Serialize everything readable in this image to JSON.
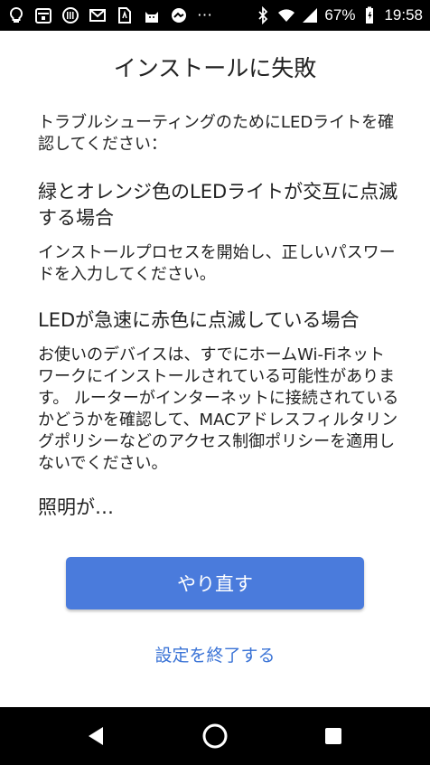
{
  "status_bar": {
    "icons": [
      "lightbulb-icon",
      "calendar-icon",
      "barcode-icon",
      "gmail-icon",
      "document-icon",
      "cat-icon",
      "camera-icon",
      "more-dots-icon",
      "bluetooth-icon",
      "wifi-icon",
      "signal-icon",
      "battery-icon"
    ],
    "dots": "⋯",
    "battery_percent": "67%",
    "time": "19:58"
  },
  "dialog": {
    "title": "インストールに失敗",
    "intro": "トラブルシューティングのためにLEDライトを確認してください：",
    "sections": [
      {
        "heading": "緑とオレンジ色のLEDライトが交互に点滅する場合",
        "body": "インストールプロセスを開始し、正しいパスワードを入力してください。"
      },
      {
        "heading": "LEDが急速に赤色に点滅している場合",
        "body": "お使いのデバイスは、すでにホームWi-Fiネットワークにインストールされている可能性があります。 ルーターがインターネットに接続されているかどうかを確認して、MACアドレスフィルタリングポリシーなどのアクセス制御ポリシーを適用しないでください。"
      },
      {
        "heading": "照明が…",
        "body": ""
      }
    ],
    "retry_label": "やり直す",
    "exit_label": "設定を終了する"
  },
  "colors": {
    "primary_button": "#4a7bdc",
    "link": "#3a73d6",
    "status_bar_bg": "#000000"
  }
}
